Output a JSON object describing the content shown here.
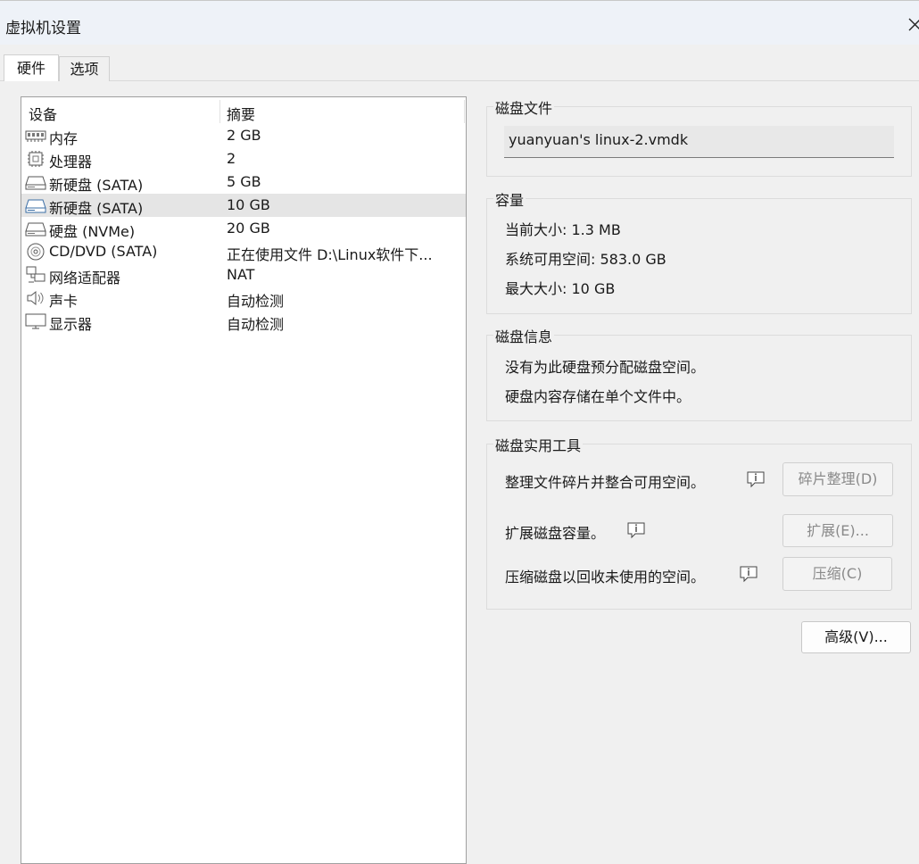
{
  "window": {
    "title": "虚拟机设置"
  },
  "tabs": [
    {
      "label": "硬件",
      "active": true
    },
    {
      "label": "选项",
      "active": false
    }
  ],
  "device_table": {
    "columns": [
      "设备",
      "摘要"
    ],
    "rows": [
      {
        "icon": "memory-icon",
        "device": "内存",
        "summary": "2 GB"
      },
      {
        "icon": "processor-icon",
        "device": "处理器",
        "summary": "2"
      },
      {
        "icon": "hard-disk-icon",
        "device": "新硬盘 (SATA)",
        "summary": "5 GB"
      },
      {
        "icon": "hard-disk-icon",
        "device": "新硬盘 (SATA)",
        "summary": "10 GB",
        "selected": true
      },
      {
        "icon": "hard-disk-icon",
        "device": "硬盘 (NVMe)",
        "summary": "20 GB"
      },
      {
        "icon": "cd-dvd-icon",
        "device": "CD/DVD (SATA)",
        "summary": "正在使用文件 D:\\Linux软件下..."
      },
      {
        "icon": "network-adapter-icon",
        "device": "网络适配器",
        "summary": "NAT"
      },
      {
        "icon": "speaker-icon",
        "device": "声卡",
        "summary": "自动检测"
      },
      {
        "icon": "monitor-icon",
        "device": "显示器",
        "summary": "自动检测"
      }
    ]
  },
  "disk_file": {
    "title": "磁盘文件",
    "value": "yuanyuan's linux-2.vmdk"
  },
  "capacity": {
    "title": "容量",
    "current_label": "当前大小:",
    "current_value": "1.3 MB",
    "available_label": "系统可用空间:",
    "available_value": "583.0 GB",
    "max_label": "最大大小:",
    "max_value": "10 GB"
  },
  "disk_info": {
    "title": "磁盘信息",
    "line1": "没有为此硬盘预分配磁盘空间。",
    "line2": "硬盘内容存储在单个文件中。"
  },
  "disk_utilities": {
    "title": "磁盘实用工具",
    "defrag_desc": "整理文件碎片并整合可用空间。",
    "defrag_button": "碎片整理(D)",
    "expand_desc": "扩展磁盘容量。",
    "expand_button": "扩展(E)...",
    "compact_desc": "压缩磁盘以回收未使用的空间。",
    "compact_button": "压缩(C)"
  },
  "advanced_button": "高级(V)...",
  "colors": {
    "selected_row": "#e5e5e5",
    "titlebar": "#eef2f8",
    "window_bg": "#f0f0f0",
    "disabled_text": "#8a8a8a"
  }
}
